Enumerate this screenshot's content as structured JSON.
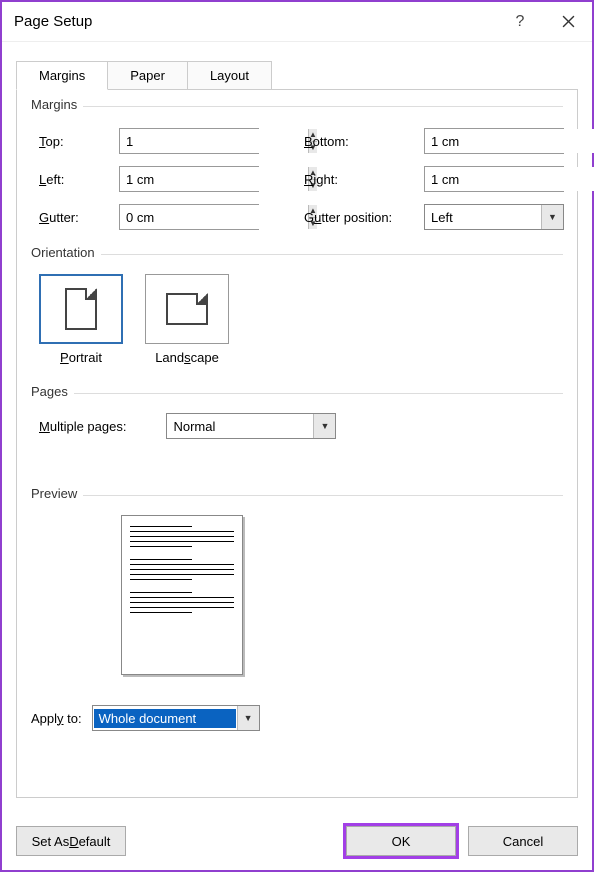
{
  "title": "Page Setup",
  "tabs": {
    "margins": "Margins",
    "paper": "Paper",
    "layout": "Layout"
  },
  "margins": {
    "legend": "Margins",
    "top_label": "Top:",
    "top_value": "1",
    "bottom_label": "Bottom:",
    "bottom_value": "1 cm",
    "left_label": "Left:",
    "left_value": "1 cm",
    "right_label": "Right:",
    "right_value": "1 cm",
    "gutter_label": "Gutter:",
    "gutter_value": "0 cm",
    "gutter_pos_label": "Gutter position:",
    "gutter_pos_value": "Left"
  },
  "orientation": {
    "legend": "Orientation",
    "portrait": "Portrait",
    "landscape": "Landscape",
    "selected": "portrait"
  },
  "pages": {
    "legend": "Pages",
    "multi_label": "Multiple pages:",
    "multi_value": "Normal"
  },
  "preview": {
    "legend": "Preview"
  },
  "apply": {
    "label": "Apply to:",
    "value": "Whole document"
  },
  "buttons": {
    "default": "Set As Default",
    "ok": "OK",
    "cancel": "Cancel"
  }
}
